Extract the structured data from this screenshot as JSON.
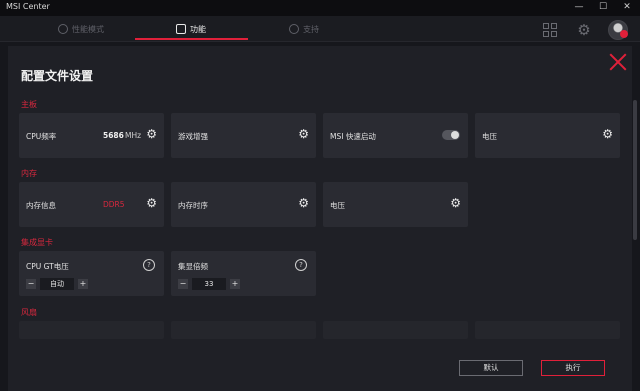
{
  "app": {
    "title": "MSI Center"
  },
  "window_controls": {
    "minimize": "—",
    "maximize": "☐",
    "close": "✕"
  },
  "nav": {
    "tabs": [
      {
        "label": "性能模式",
        "active": false
      },
      {
        "label": "功能",
        "active": true
      },
      {
        "label": "支持",
        "active": false
      }
    ],
    "icons": [
      "grid-icon",
      "gear-icon",
      "avatar"
    ]
  },
  "page": {
    "title": "配置文件设置"
  },
  "sections": {
    "motherboard": {
      "label": "主板",
      "cpu_freq": {
        "label": "CPU频率",
        "value": "5686",
        "unit": "MHz"
      },
      "game_boost": {
        "label": "游戏增强"
      },
      "msi_fast_boot": {
        "label": "MSI 快速启动",
        "enabled": false
      },
      "voltage": {
        "label": "电压"
      }
    },
    "memory": {
      "label": "内存",
      "info": {
        "label": "内存信息",
        "value": "DDR5"
      },
      "timing": {
        "label": "内存时序"
      },
      "voltage": {
        "label": "电压"
      }
    },
    "igpu": {
      "label": "集成显卡",
      "gt_voltage": {
        "label": "CPU GT电压",
        "value": "自动",
        "minus": "−",
        "plus": "+",
        "help": "?"
      },
      "ratio": {
        "label": "集显倍频",
        "value": "33",
        "minus": "−",
        "plus": "+",
        "help": "?"
      }
    },
    "fan": {
      "label": "风扇"
    }
  },
  "gear_glyph": "⚙",
  "buttons": {
    "default": "默认",
    "apply": "执行"
  },
  "colors": {
    "accent": "#e0203a",
    "background": "#16171c",
    "card": "#2a2b32"
  }
}
